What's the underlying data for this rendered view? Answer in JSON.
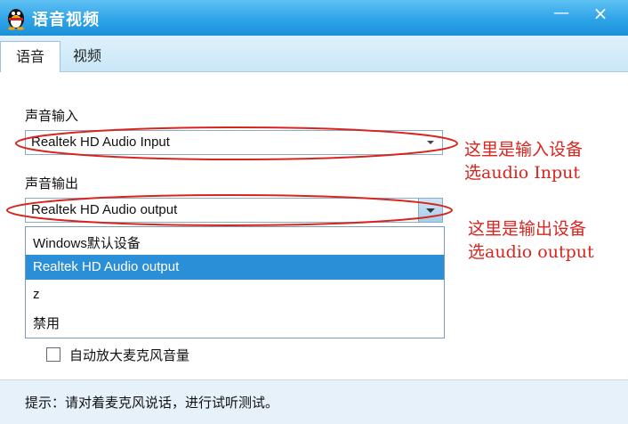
{
  "window": {
    "title": "语音视频",
    "minimize_symbol": "—",
    "close_symbol": "×"
  },
  "tabs": [
    {
      "label": "语音"
    },
    {
      "label": "视频"
    }
  ],
  "input_section": {
    "label": "声音输入",
    "selected_device": "Realtek HD Audio Input"
  },
  "output_section": {
    "label": "声音输出",
    "selected_device": "Realtek HD Audio output",
    "options": [
      {
        "label": "Windows默认设备"
      },
      {
        "label": "Realtek HD Audio output",
        "selected": true
      },
      {
        "label": "z"
      },
      {
        "label": "禁用"
      }
    ]
  },
  "auto_boost": {
    "label": "自动放大麦克风音量",
    "checked": false
  },
  "footer": {
    "hint": "提示：请对着麦克风说话，进行试听测试。"
  },
  "annotations": {
    "input_note_line1": "这里是输入设备",
    "input_note_line2": "选audio Input",
    "output_note_line1": "这里是输出设备",
    "output_note_line2": "选audio output",
    "color": "#d8251f"
  }
}
